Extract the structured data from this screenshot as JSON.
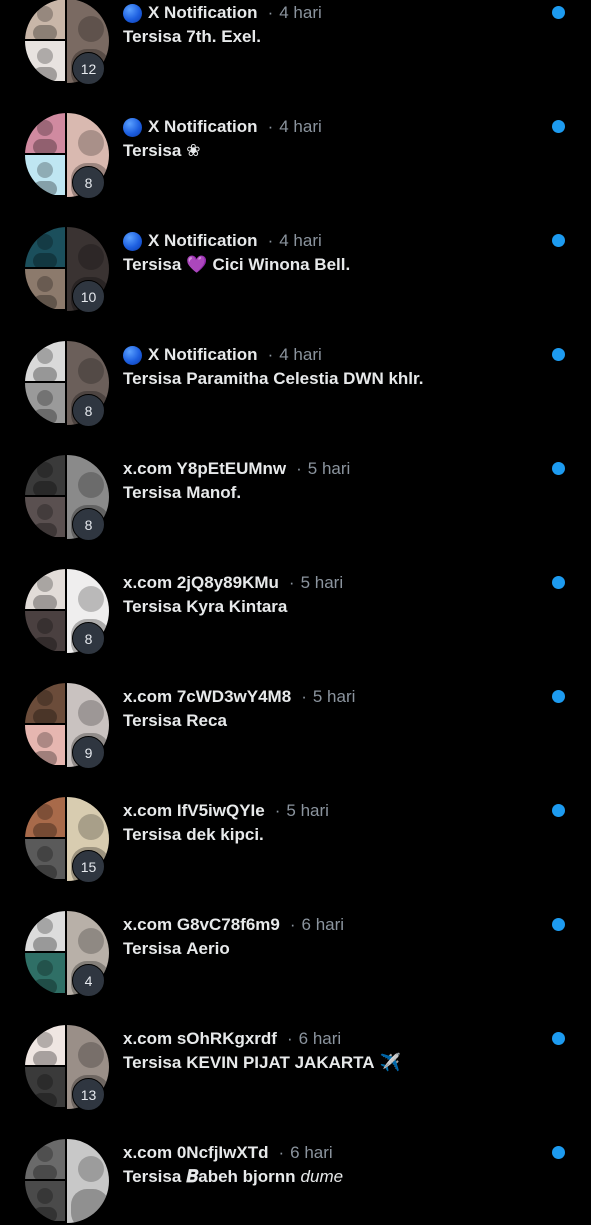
{
  "notifications": [
    {
      "sender": "X Notification",
      "verified_globe": true,
      "time": "4 hari",
      "prefix": "Tersisa",
      "text": "7th. Exel.",
      "count": "12",
      "avatars": {
        "tl": "#c8b6a8",
        "bl": "#e8e3e0",
        "right": "#7a6a62"
      }
    },
    {
      "sender": "X Notification",
      "verified_globe": true,
      "time": "4 hari",
      "prefix": "Tersisa",
      "text": "❀",
      "count": "8",
      "avatars": {
        "tl": "#d08aa0",
        "bl": "#bfe6f2",
        "right": "#d9b9b0"
      }
    },
    {
      "sender": "X Notification",
      "verified_globe": true,
      "time": "4 hari",
      "prefix": "Tersisa",
      "emoji": "💜",
      "text": "Cici Winona Bell.",
      "count": "10",
      "avatars": {
        "tl": "#1b4f5c",
        "bl": "#8c7a6c",
        "right": "#3a3332"
      }
    },
    {
      "sender": "X Notification",
      "verified_globe": true,
      "time": "4 hari",
      "prefix": "Tersisa",
      "text": "Paramitha Celestia DWN khlr.",
      "count": "8",
      "avatars": {
        "tl": "#d9d9d9",
        "bl": "#9a9a9a",
        "right": "#6b5f5a"
      }
    },
    {
      "sender": "x.com Y8pEtEUMnw",
      "verified_globe": false,
      "time": "5 hari",
      "prefix": "Tersisa",
      "text": "Manof.",
      "count": "8",
      "avatars": {
        "tl": "#3a3a3a",
        "bl": "#5a5050",
        "right": "#8a8a8a"
      }
    },
    {
      "sender": "x.com 2jQ8y89KMu",
      "verified_globe": false,
      "time": "5 hari",
      "prefix": "Tersisa",
      "text": "Kyra Kintara",
      "count": "8",
      "avatars": {
        "tl": "#e2dcd8",
        "bl": "#4a4040",
        "right": "#efeeee"
      }
    },
    {
      "sender": "x.com 7cWD3wY4M8",
      "verified_globe": false,
      "time": "5 hari",
      "prefix": "Tersisa",
      "text": "Reca",
      "count": "9",
      "avatars": {
        "tl": "#6b4c3a",
        "bl": "#e6b6b0",
        "right": "#c9c2c0"
      }
    },
    {
      "sender": "x.com IfV5iwQYIe",
      "verified_globe": false,
      "time": "5 hari",
      "prefix": "Tersisa",
      "text": "dek kipci.",
      "count": "15",
      "avatars": {
        "tl": "#a86a4a",
        "bl": "#5a5a5a",
        "right": "#d8ccb0"
      }
    },
    {
      "sender": "x.com G8vC78f6m9",
      "verified_globe": false,
      "time": "6 hari",
      "prefix": "Tersisa",
      "text": "Aerio",
      "count": "4",
      "avatars": {
        "tl": "#dcdcdc",
        "bl": "#2f6f66",
        "right": "#b8b0a8"
      }
    },
    {
      "sender": "x.com sOhRKgxrdf",
      "verified_globe": false,
      "time": "6 hari",
      "prefix": "Tersisa",
      "text": "KEVIN PIJAT JAKARTA",
      "trailing_emoji": "✈️",
      "count": "13",
      "avatars": {
        "tl": "#efe6e2",
        "bl": "#3a3a3a",
        "right": "#9a8f88"
      }
    },
    {
      "sender": "x.com 0NcfjIwXTd",
      "verified_globe": false,
      "time": "6 hari",
      "prefix": "Tersisa",
      "text": "𝑩abeh bjornn",
      "italic_text": "dume",
      "count": "",
      "avatars": {
        "tl": "#6a6a6a",
        "bl": "#4a4a4a",
        "right": "#c8c8c8"
      }
    }
  ],
  "colors": {
    "unread_dot": "#1d9bf0",
    "background": "#000000",
    "muted": "#8b949e"
  }
}
